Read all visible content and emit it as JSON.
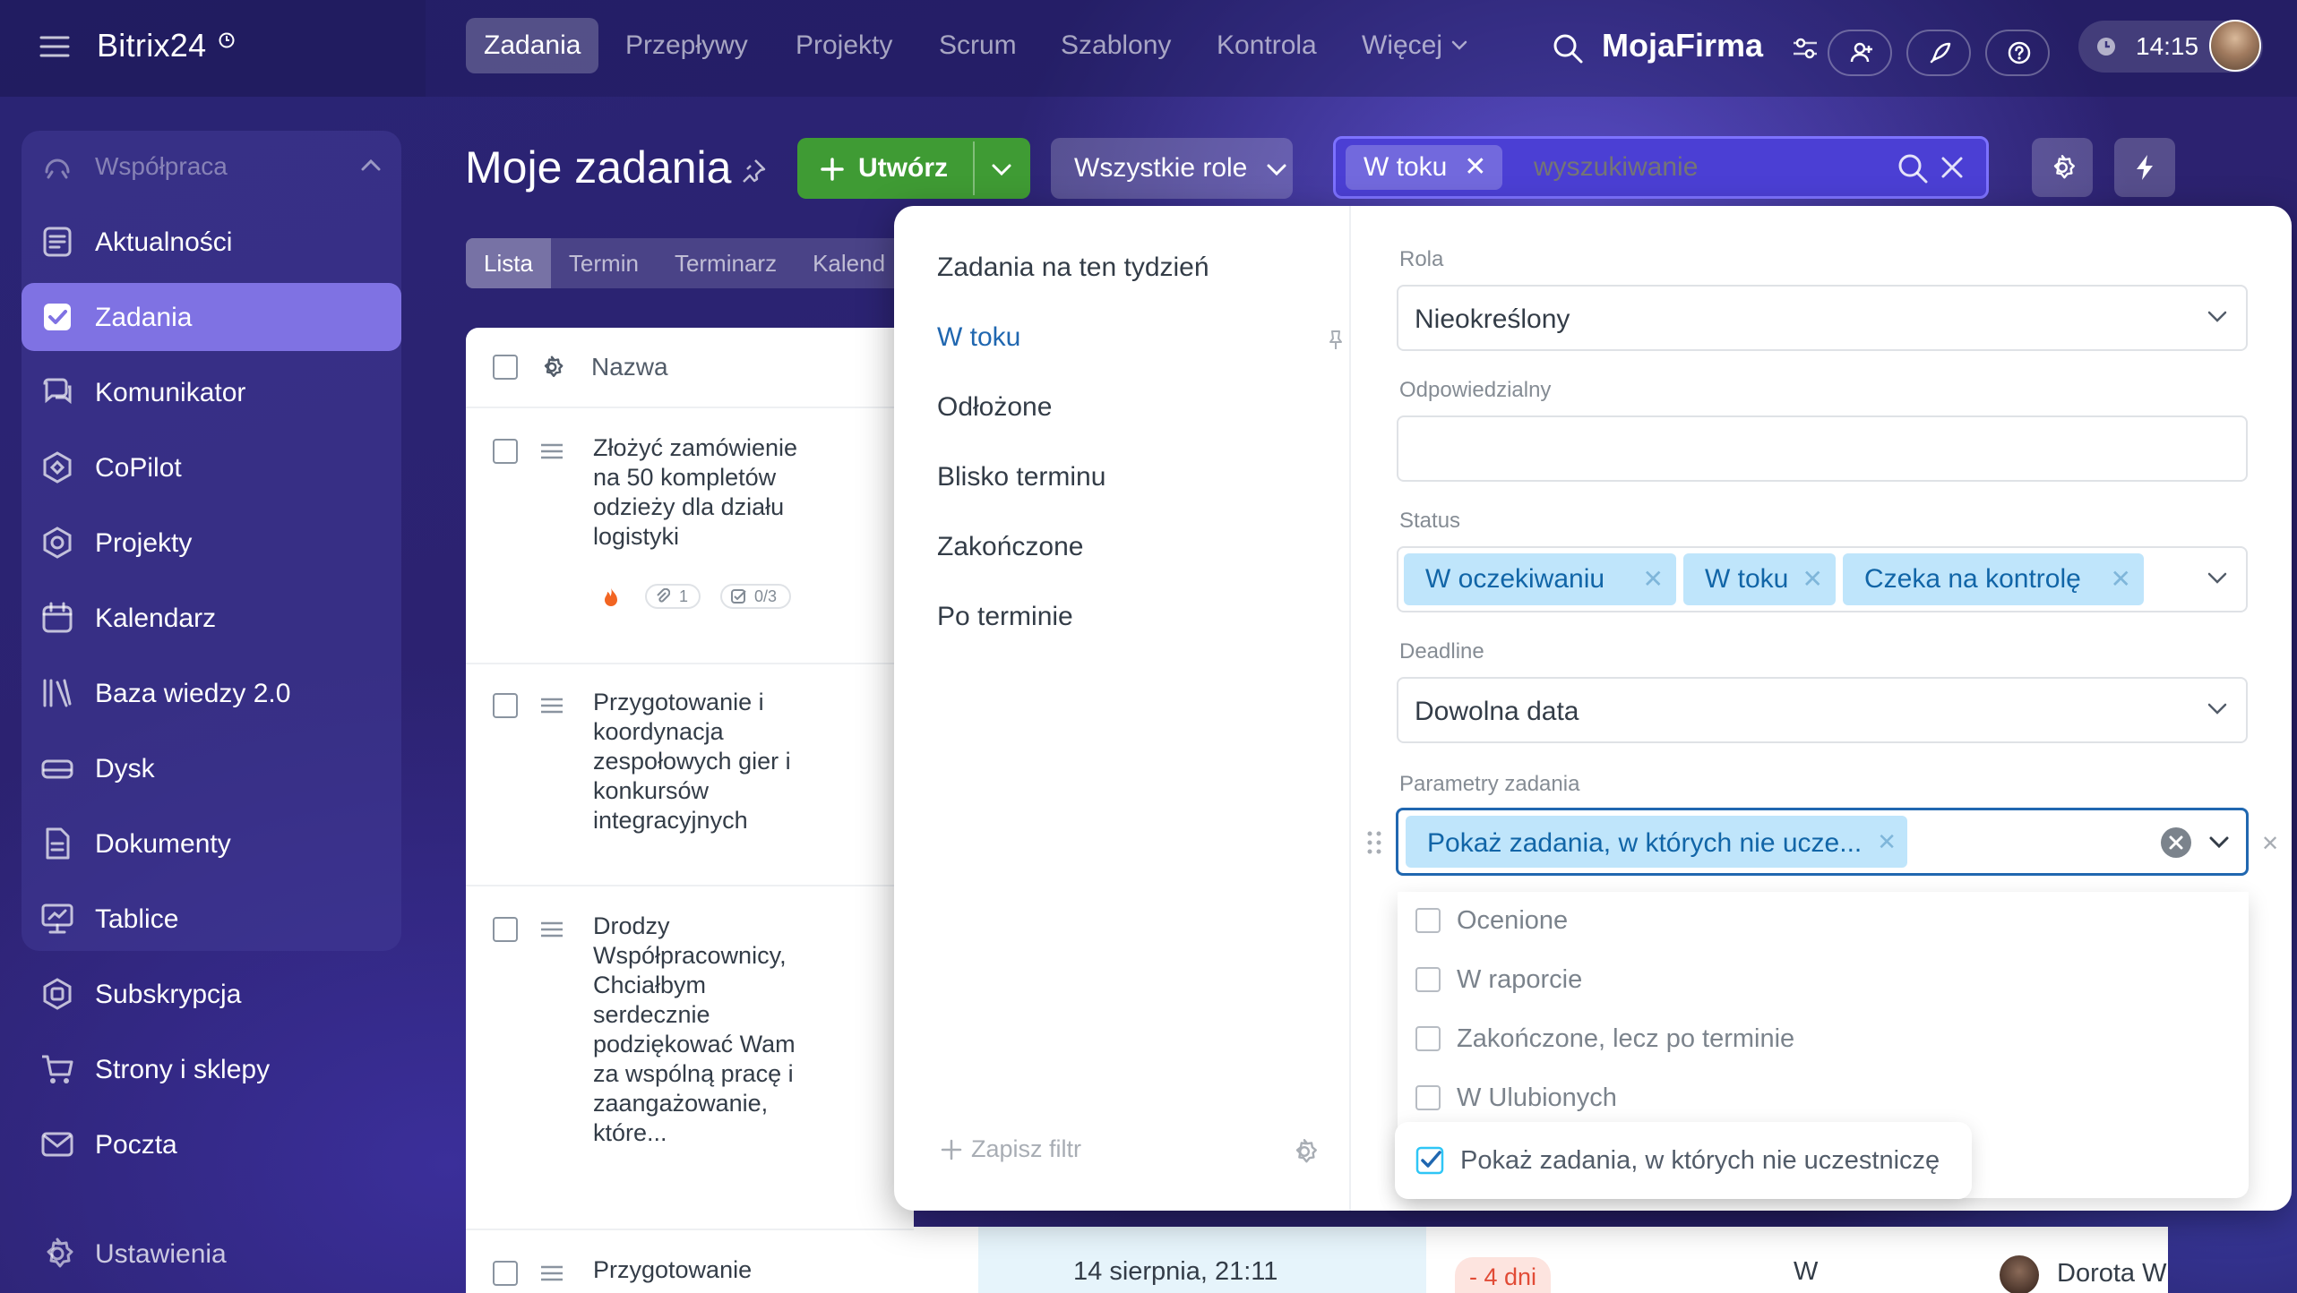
{
  "brand": {
    "name": "Bitrix24"
  },
  "sidebar": {
    "section_label": "Współpraca",
    "items": [
      {
        "label": "Aktualności"
      },
      {
        "label": "Zadania"
      },
      {
        "label": "Komunikator"
      },
      {
        "label": "CoPilot"
      },
      {
        "label": "Projekty"
      },
      {
        "label": "Kalendarz"
      },
      {
        "label": "Baza wiedzy 2.0"
      },
      {
        "label": "Dysk"
      },
      {
        "label": "Dokumenty"
      },
      {
        "label": "Tablice"
      },
      {
        "label": "Subskrypcja"
      },
      {
        "label": "Strony i sklepy"
      },
      {
        "label": "Poczta"
      }
    ],
    "settings_label": "Ustawienia"
  },
  "topnav": {
    "items": [
      "Zadania",
      "Przepływy",
      "Projekty",
      "Scrum",
      "Szablony",
      "Kontrola",
      "Więcej"
    ],
    "company": "MojaFirma",
    "time": "14:15"
  },
  "header": {
    "title": "Moje zadania",
    "create_label": "Utwórz",
    "roles_label": "Wszystkie role",
    "search_chip": "W toku",
    "search_placeholder": "wyszukiwanie"
  },
  "view_tabs": [
    "Lista",
    "Termin",
    "Terminarz",
    "Kalend"
  ],
  "task_list": {
    "column_name": "Nazwa",
    "tasks": [
      {
        "title": "Złożyć zamówienie na 50 kompletów odzieży dla działu logistyki",
        "comments": "1",
        "checklist": "0/3"
      },
      {
        "title": "Przygotowanie i koordynacja zespołowych gier i konkursów integracyjnych"
      },
      {
        "title": "Drodzy Współpracownicy, Chciałbym serdecznie podziękować Wam za wspólną pracę i zaangażowanie, które..."
      },
      {
        "title": "Przygotowanie",
        "deadline": "14 sierpnia, 21:11",
        "overdue": "- 4 dni",
        "status": "W",
        "responsible": "Dorota Wi"
      }
    ]
  },
  "filter": {
    "presets": [
      "Zadania na ten tydzień",
      "W toku",
      "Odłożone",
      "Blisko terminu",
      "Zakończone",
      "Po terminie"
    ],
    "save_label": "Zapisz filtr",
    "fields": {
      "role_label": "Rola",
      "role_value": "Nieokreślony",
      "responsible_label": "Odpowiedzialny",
      "status_label": "Status",
      "status_tags": [
        "W oczekiwaniu",
        "W toku",
        "Czeka na kontrolę"
      ],
      "deadline_label": "Deadline",
      "deadline_value": "Dowolna data",
      "params_label": "Parametry zadania",
      "params_tag": "Pokaż zadania, w których nie ucze..."
    },
    "options": [
      {
        "label": "Ocenione",
        "checked": false
      },
      {
        "label": "W raporcie",
        "checked": false
      },
      {
        "label": "Zakończone, lecz po terminie",
        "checked": false
      },
      {
        "label": "W Ulubionych",
        "checked": false
      },
      {
        "label": "Pokaż zadania, w których nie uczestniczę",
        "checked": true
      }
    ]
  },
  "colors": {
    "accent": "#2067b0",
    "create": "#3f9b34",
    "checkbox_checked": "#2fc6f6",
    "overdue": "#e14b36"
  }
}
